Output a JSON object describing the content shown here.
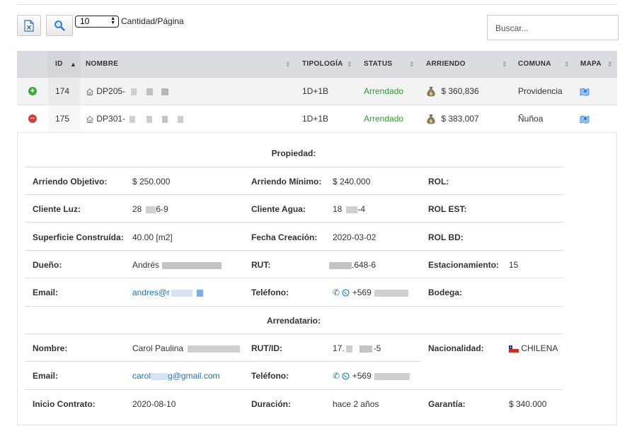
{
  "toolbar": {
    "excel_icon": "excel-export-icon",
    "search_icon": "magnifier-icon",
    "page_size_value": "10",
    "page_size_label": "Cantidad/Página",
    "search_placeholder": "Buscar..."
  },
  "table": {
    "headers": {
      "id": "ID",
      "nombre": "NOMBRE",
      "tipologia": "TIPOLOGÍA",
      "status": "STATUS",
      "arriendo": "ARRIENDO",
      "comuna": "COMUNA",
      "mapa": "MAPA"
    },
    "rows": [
      {
        "id": "174",
        "nombre": "DP205-",
        "tipologia": "1D+1B",
        "status": "Arrendado",
        "arriendo": "$ 360,836",
        "comuna": "Providencia",
        "control": "expand-plus"
      },
      {
        "id": "175",
        "nombre": "DP301-",
        "tipologia": "1D+1B",
        "status": "Arrendado",
        "arriendo": "$ 383,007",
        "comuna": "Ñuñoa",
        "control": "collapse-minus"
      }
    ]
  },
  "detail": {
    "propiedad_title": "Propiedad:",
    "arrendatario_title": "Arrendatario:",
    "propiedad": {
      "arriendo_objetivo_label": "Arriendo Objetivo:",
      "arriendo_objetivo": "$ 250.000",
      "arriendo_minimo_label": "Arriendo Mínimo:",
      "arriendo_minimo": "$ 240.000",
      "rol_label": "ROL:",
      "cliente_luz_label": "Cliente Luz:",
      "cliente_luz_a": "28",
      "cliente_luz_b": "6-9",
      "cliente_agua_label": "Cliente Agua:",
      "cliente_agua_a": "18",
      "cliente_agua_b": "-4",
      "rol_est_label": "ROL EST:",
      "superficie_label": "Superficie Construída:",
      "superficie": "40.00 [m2]",
      "fecha_creacion_label": "Fecha Creación:",
      "fecha_creacion": "2020-03-02",
      "rol_bd_label": "ROL BD:",
      "dueno_label": "Dueño:",
      "dueno": "Andrés",
      "rut_label": "RUT:",
      "rut": ".648-6",
      "estacionamiento_label": "Estacionamiento:",
      "estacionamiento": "15",
      "email_label": "Email:",
      "email": "andres@r",
      "telefono_label": "Teléfono:",
      "telefono": "+569",
      "bodega_label": "Bodega:"
    },
    "arrendatario": {
      "nombre_label": "Nombre:",
      "nombre": "Carol Paulina",
      "rut_label": "RUT/ID:",
      "rut_a": "17.",
      "rut_b": "-5",
      "nacionalidad_label": "Nacionalidad:",
      "nacionalidad": "CHILENA",
      "email_label": "Email:",
      "email_a": "carol",
      "email_b": "g@gmail.com",
      "telefono_label": "Teléfono:",
      "telefono": "+569",
      "inicio_label": "Inicio Contrato:",
      "inicio": "2020-08-10",
      "duracion_label": "Duración:",
      "duracion": "hace 2 años",
      "garantia_label": "Garantía:",
      "garantia": "$ 340.000"
    }
  },
  "colors": {
    "status_green": "#2a9d2a",
    "link_blue": "#1a73c9",
    "header_bg": "#d9dde1"
  }
}
